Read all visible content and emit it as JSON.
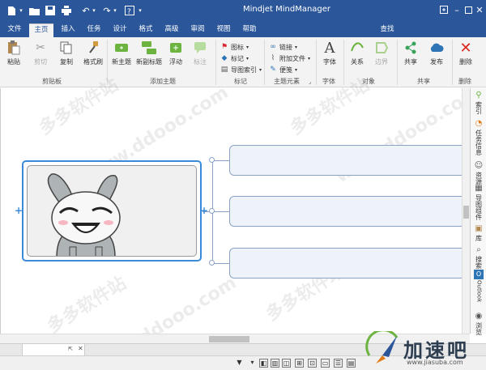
{
  "app": {
    "title": "Mindjet MindManager"
  },
  "tabs": [
    "文件",
    "主页",
    "插入",
    "任务",
    "设计",
    "格式",
    "高级",
    "审阅",
    "视图",
    "帮助"
  ],
  "search_label": "查找",
  "ribbon": {
    "clipboard": {
      "paste": "粘贴",
      "cut": "剪切",
      "copy": "复制",
      "format_painter": "格式刷",
      "group": "剪贴板"
    },
    "add_topic": {
      "new_topic": "新主题",
      "new_subtopic": "新副标题",
      "floating": "浮动",
      "callout": "标注",
      "group": "添加主题"
    },
    "markers": {
      "icon": "图标",
      "tag": "标记",
      "map_index": "导图索引",
      "group": "标记"
    },
    "topic_elements": {
      "link": "链接",
      "attach": "附加文件",
      "note": "便笺",
      "group": "主题元素"
    },
    "font": {
      "font": "字体",
      "group": "字体"
    },
    "objects": {
      "relation": "关系",
      "boundary": "边界",
      "group": "对象"
    },
    "share": {
      "share": "共享",
      "publish": "发布",
      "group": "共享"
    },
    "delete": {
      "delete": "删除",
      "group": "删除"
    }
  },
  "right_panel": [
    "索引",
    "任务信息",
    "资源",
    "导图组件",
    "库",
    "搜索",
    "Outlook",
    "浏览"
  ],
  "watermarks": [
    "多多软件站",
    "www.ddooo.com"
  ],
  "logo": {
    "text": "加速吧",
    "url": "www.jiasuba.com"
  },
  "colors": {
    "title_bar": "#2b579a",
    "topic_border": "#3a8ad8",
    "subtopic_fill": "#eef2f9"
  }
}
